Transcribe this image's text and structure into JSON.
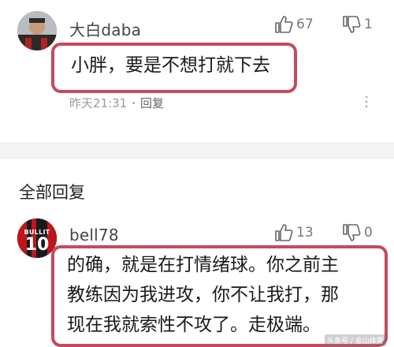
{
  "comment1": {
    "username": "大白daba",
    "likes": "67",
    "dislikes": "1",
    "text": "小胖，要是不想打就下去",
    "time": "昨天21:31",
    "separator": "·",
    "reply_label": "回复"
  },
  "section": {
    "title": "全部回复"
  },
  "comment2": {
    "username": "bell78",
    "likes": "13",
    "dislikes": "0",
    "avatar_text": "BULLIT",
    "avatar_number": "10",
    "text_line1": "的确，就是在打情绪球。你之前主",
    "text_line2": "教练因为我进攻，你不让我打，那",
    "text_line3": "现在我就索性不攻了。走极端。"
  },
  "watermark": "头条号 / 金山体育",
  "colors": {
    "highlight_border": "#c34b5e",
    "section_band": "#f4f4f4",
    "muted_text": "#9a9a9a"
  },
  "icons": [
    "thumbs-up-icon",
    "thumbs-down-icon",
    "more-options-icon"
  ]
}
